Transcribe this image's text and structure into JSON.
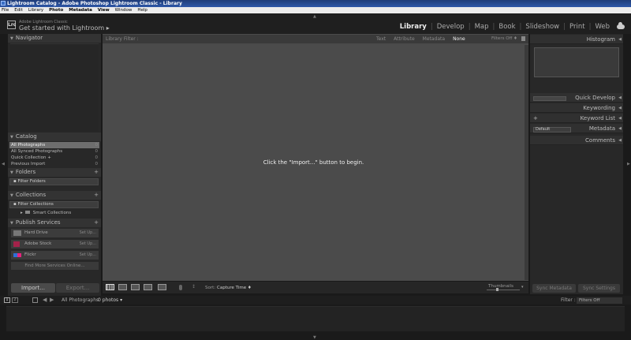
{
  "window": {
    "title": "Lightroom Catalog - Adobe Photoshop Lightroom Classic - Library"
  },
  "menubar": [
    "File",
    "Edit",
    "Library",
    "Photo",
    "Metadata",
    "View",
    "Window",
    "Help"
  ],
  "brand": {
    "logo": "Lrc",
    "small": "Adobe Lightroom Classic",
    "big": "Get started with Lightroom ▸"
  },
  "modules": {
    "items": [
      "Library",
      "Develop",
      "Map",
      "Book",
      "Slideshow",
      "Print",
      "Web"
    ],
    "active": "Library"
  },
  "left_panel": {
    "navigator": {
      "title": "Navigator"
    },
    "catalog": {
      "title": "Catalog",
      "items": [
        {
          "label": "All Photographs",
          "count": "0"
        },
        {
          "label": "All Synced Photographs",
          "count": "0"
        },
        {
          "label": "Quick Collection +",
          "count": "0"
        },
        {
          "label": "Previous Import",
          "count": "0"
        }
      ]
    },
    "folders": {
      "title": "Folders",
      "filter": "Filter Folders"
    },
    "collections": {
      "title": "Collections",
      "filter": "Filter Collections",
      "smart": "Smart Collections"
    },
    "publish": {
      "title": "Publish Services",
      "items": [
        {
          "label": "Hard Drive",
          "action": "Set Up..."
        },
        {
          "label": "Adobe Stock",
          "action": "Set Up..."
        },
        {
          "label": "Flickr",
          "action": "Set Up..."
        }
      ],
      "find_more": "Find More Services Online..."
    },
    "import_label": "Import...",
    "export_label": "Export..."
  },
  "library_filter": {
    "label": "Library Filter :",
    "tabs": [
      "Text",
      "Attribute",
      "Metadata",
      "None"
    ],
    "active": "None",
    "filters_off": "Filters Off ♦"
  },
  "center": {
    "message": "Click the \"Import...\" button to begin."
  },
  "toolbar": {
    "sort_label": "Sort:",
    "sort_value": "Capture Time ♦",
    "thumbnails_label": "Thumbnails"
  },
  "right_panel": {
    "histogram": "Histogram",
    "quick_develop": "Quick Develop",
    "keywording": "Keywording",
    "keyword_list": "Keyword List",
    "metadata": "Metadata",
    "metadata_preset": "Default",
    "comments": "Comments",
    "sync_metadata": "Sync Metadata",
    "sync_settings": "Sync Settings"
  },
  "filmstrip": {
    "screen1": "1",
    "screen2": "2",
    "source": "All Photographs",
    "count": "0 photos ▾",
    "filter_label": "Filter :",
    "filter_value": "Filters Off"
  }
}
